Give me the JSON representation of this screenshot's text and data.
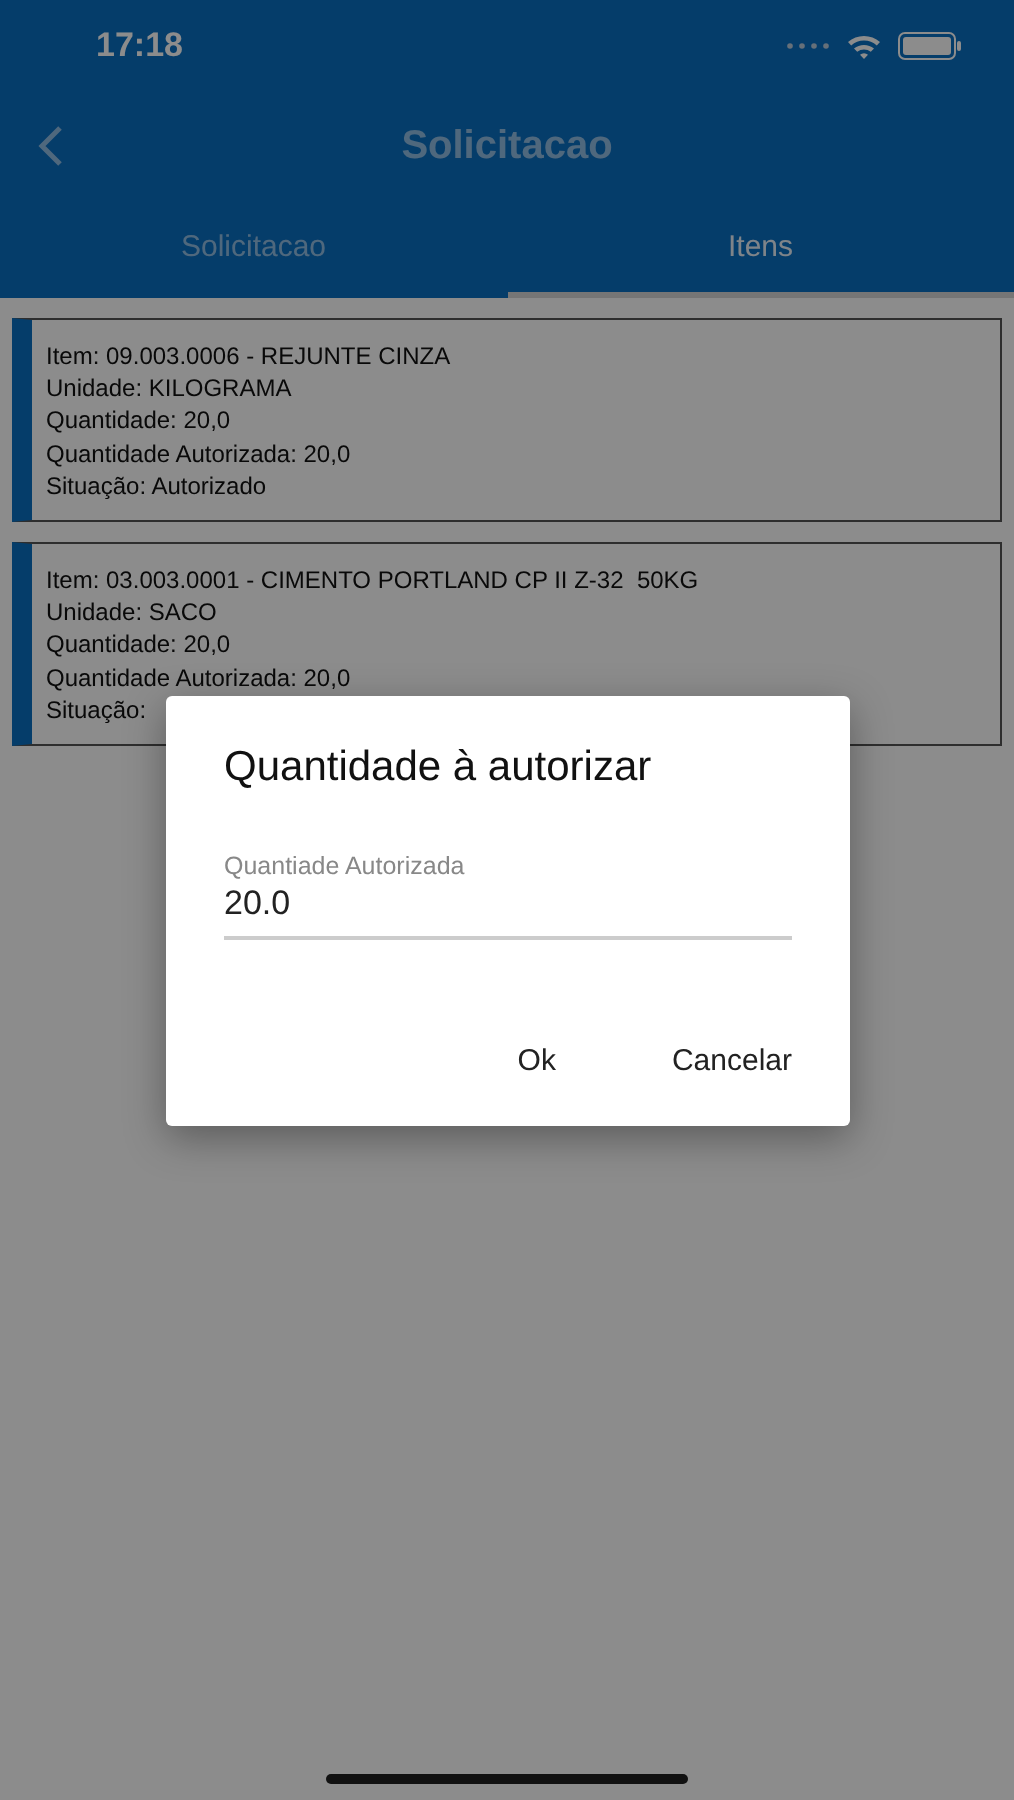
{
  "status_bar": {
    "time": "17:18"
  },
  "header": {
    "title": "Solicitacao"
  },
  "tabs": [
    {
      "label": "Solicitacao",
      "selected": false
    },
    {
      "label": "Itens",
      "selected": true
    }
  ],
  "items": [
    {
      "lines": [
        "Item: 09.003.0006 - REJUNTE CINZA",
        "Unidade: KILOGRAMA",
        "Quantidade: 20,0",
        "Quantidade Autorizada: 20,0",
        "Situação: Autorizado"
      ]
    },
    {
      "lines": [
        "Item: 03.003.0001 - CIMENTO PORTLAND CP II Z-32  50KG",
        "Unidade: SACO",
        "Quantidade: 20,0",
        "Quantidade Autorizada: 20,0",
        "Situação:"
      ]
    }
  ],
  "dialog": {
    "title": "Quantidade à autorizar",
    "field": {
      "label": "Quantiade Autorizada",
      "value": "20.0"
    },
    "buttons": [
      "Ok",
      "Cancelar"
    ]
  }
}
